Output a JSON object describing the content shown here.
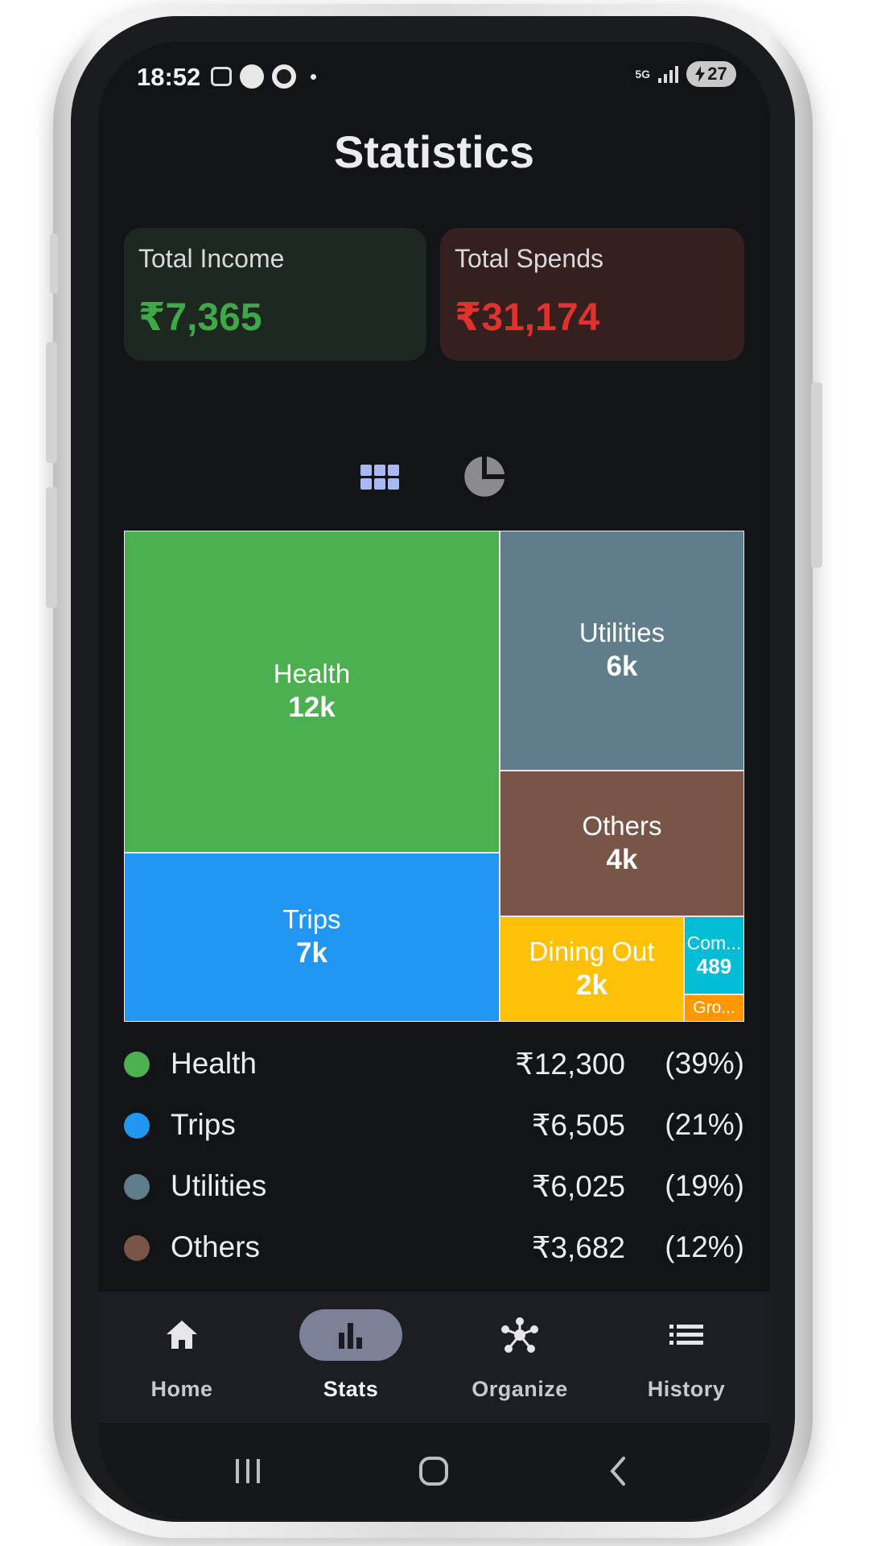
{
  "status_bar": {
    "time": "18:52",
    "network": "5G",
    "battery": "27"
  },
  "page": {
    "title": "Statistics"
  },
  "summary": {
    "income_label": "Total Income",
    "income_value": "₹7,365",
    "spends_label": "Total Spends",
    "spends_value": "₹31,174"
  },
  "view_toggle": {
    "options": [
      "grid-view-icon",
      "pie-chart-icon"
    ],
    "selected": "grid-view-icon",
    "selected_color": "#a9b9f5"
  },
  "chart_data": {
    "type": "treemap",
    "tiles": [
      {
        "name": "Health",
        "display": "12k",
        "value": 12300,
        "color": "#4caf50"
      },
      {
        "name": "Trips",
        "display": "7k",
        "value": 6505,
        "color": "#2196f3"
      },
      {
        "name": "Utilities",
        "display": "6k",
        "value": 6025,
        "color": "#607d8b"
      },
      {
        "name": "Others",
        "display": "4k",
        "value": 3682,
        "color": "#795548"
      },
      {
        "name": "Dining Out",
        "display": "2k",
        "color": "#ffc107"
      },
      {
        "name": "Com...",
        "display": "489",
        "value": 489,
        "color": "#00bcd4"
      },
      {
        "name": "Gro...",
        "color": "#ff9800"
      }
    ]
  },
  "legend": [
    {
      "name": "Health",
      "amount": "₹12,300",
      "percent": "(39%)",
      "color": "#4caf50"
    },
    {
      "name": "Trips",
      "amount": "₹6,505",
      "percent": "(21%)",
      "color": "#2196f3"
    },
    {
      "name": "Utilities",
      "amount": "₹6,025",
      "percent": "(19%)",
      "color": "#607d8b"
    },
    {
      "name": "Others",
      "amount": "₹3,682",
      "percent": "(12%)",
      "color": "#795548"
    }
  ],
  "bottom_nav": {
    "active": "Stats",
    "items": [
      {
        "label": "Home",
        "icon": "home-icon"
      },
      {
        "label": "Stats",
        "icon": "bar-chart-icon"
      },
      {
        "label": "Organize",
        "icon": "hub-icon"
      },
      {
        "label": "History",
        "icon": "list-icon"
      }
    ]
  },
  "system_nav": {
    "buttons": [
      "recents-icon",
      "home-circle-icon",
      "back-icon"
    ]
  }
}
